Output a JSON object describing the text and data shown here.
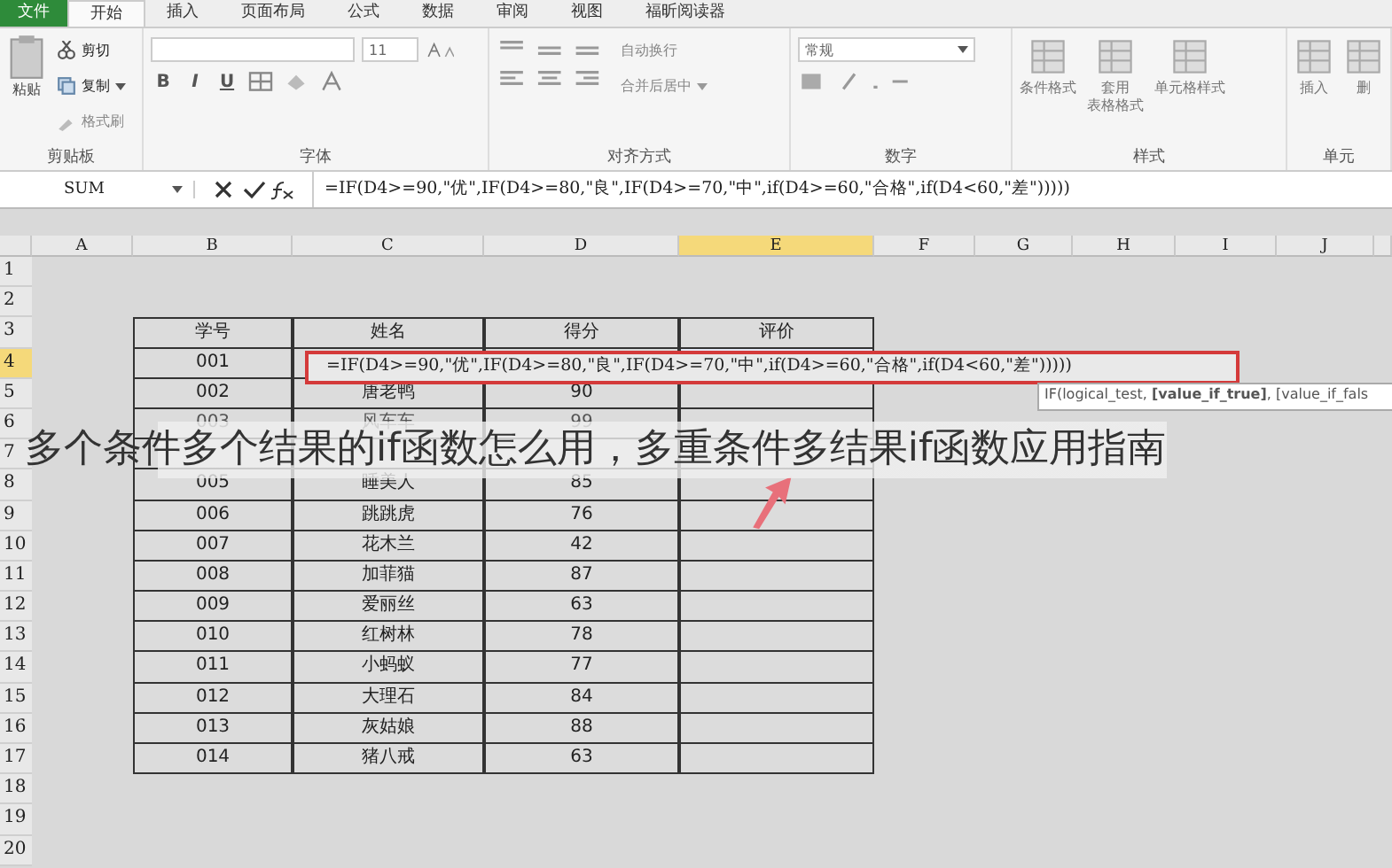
{
  "ribbon": {
    "tabs": [
      {
        "label": "文件",
        "selected": false,
        "kind": "file"
      },
      {
        "label": "开始",
        "selected": true,
        "kind": "tab"
      },
      {
        "label": "插入",
        "selected": false,
        "kind": "tab"
      },
      {
        "label": "页面布局",
        "selected": false,
        "kind": "tab"
      },
      {
        "label": "公式",
        "selected": false,
        "kind": "tab"
      },
      {
        "label": "数据",
        "selected": false,
        "kind": "tab"
      },
      {
        "label": "审阅",
        "selected": false,
        "kind": "tab"
      },
      {
        "label": "视图",
        "selected": false,
        "kind": "tab"
      },
      {
        "label": "福昕阅读器",
        "selected": false,
        "kind": "tab"
      }
    ],
    "groups": [
      {
        "kind": "clipboard",
        "label": "剪贴板",
        "paste": "粘贴",
        "cut": "剪切",
        "copy": "复制",
        "painter": "格式刷"
      },
      {
        "kind": "font",
        "label": "字体",
        "font_size": "11",
        "format_buttons": [
          "B",
          "I",
          "U"
        ]
      },
      {
        "kind": "align",
        "label": "对齐方式",
        "wrap": "自动换行",
        "merge": "合并后居中"
      },
      {
        "kind": "number",
        "label": "数字",
        "format": "常规"
      },
      {
        "kind": "styles",
        "label": "样式",
        "items": [
          [
            "条件格式"
          ],
          [
            "套用",
            "表格格式"
          ],
          [
            "单元格样式"
          ]
        ]
      },
      {
        "kind": "cells",
        "label": "单元",
        "items": [
          [
            "插入"
          ],
          [
            "删"
          ]
        ]
      }
    ]
  },
  "formula_bar": {
    "name_box": "SUM",
    "formula": "=IF(D4>=90,\"优\",IF(D4>=80,\"良\",IF(D4>=70,\"中\",if(D4>=60,\"合格\",if(D4<60,\"差\")))))"
  },
  "sheet": {
    "columns": [
      {
        "label": "A",
        "selected": false
      },
      {
        "label": "B",
        "selected": false
      },
      {
        "label": "C",
        "selected": false
      },
      {
        "label": "D",
        "selected": false
      },
      {
        "label": "E",
        "selected": true
      },
      {
        "label": "F",
        "selected": false
      },
      {
        "label": "G",
        "selected": false
      },
      {
        "label": "H",
        "selected": false
      },
      {
        "label": "I",
        "selected": false
      },
      {
        "label": "J",
        "selected": false
      }
    ],
    "row_headers": [
      {
        "label": "1",
        "selected": false
      },
      {
        "label": "2",
        "selected": false
      },
      {
        "label": "3",
        "selected": false
      },
      {
        "label": "4",
        "selected": true
      },
      {
        "label": "5",
        "selected": false
      },
      {
        "label": "6",
        "selected": false
      },
      {
        "label": "7",
        "selected": false
      },
      {
        "label": "8",
        "selected": false
      },
      {
        "label": "9",
        "selected": false
      },
      {
        "label": "10",
        "selected": false
      },
      {
        "label": "11",
        "selected": false
      },
      {
        "label": "12",
        "selected": false
      },
      {
        "label": "13",
        "selected": false
      },
      {
        "label": "14",
        "selected": false
      },
      {
        "label": "15",
        "selected": false
      },
      {
        "label": "16",
        "selected": false
      },
      {
        "label": "17",
        "selected": false
      },
      {
        "label": "18",
        "selected": false
      },
      {
        "label": "19",
        "selected": false
      },
      {
        "label": "20",
        "selected": false
      }
    ],
    "table": {
      "columns": [
        "学号",
        "姓名",
        "得分",
        "评价"
      ],
      "rows": [
        {
          "kind": "editing",
          "cells": [
            "001"
          ],
          "edit_text": "=IF(D4>=90,\"优\",IF(D4>=80,\"良\",IF(D4>=70,\"中\",if(D4>=60,\"合格\",if(D4<60,\"差\")))))"
        },
        {
          "kind": "data",
          "cells": [
            "002",
            "唐老鸭",
            "90"
          ]
        },
        {
          "kind": "faint",
          "cells": [
            "003",
            "风车车",
            "99"
          ]
        },
        {
          "kind": "covered"
        },
        {
          "kind": "data",
          "cells": [
            "005",
            "睡美人",
            "85"
          ]
        },
        {
          "kind": "data",
          "cells": [
            "006",
            "跳跳虎",
            "76"
          ]
        },
        {
          "kind": "data",
          "cells": [
            "007",
            "花木兰",
            "42"
          ]
        },
        {
          "kind": "data",
          "cells": [
            "008",
            "加菲猫",
            "87"
          ]
        },
        {
          "kind": "data",
          "cells": [
            "009",
            "爱丽丝",
            "63"
          ]
        },
        {
          "kind": "data",
          "cells": [
            "010",
            "红树林",
            "78"
          ]
        },
        {
          "kind": "data",
          "cells": [
            "011",
            "小蚂蚁",
            "77"
          ]
        },
        {
          "kind": "data",
          "cells": [
            "012",
            "大理石",
            "84"
          ]
        },
        {
          "kind": "data",
          "cells": [
            "013",
            "灰姑娘",
            "88"
          ]
        },
        {
          "kind": "data",
          "cells": [
            "014",
            "猪八戒",
            "63"
          ]
        }
      ]
    },
    "tooltip": "IF(logical_test, **[value_if_true]**, [value_if_fals"
  },
  "caption": "多个条件多个结果的if函数怎么用，多重条件多结果if函数应用指南"
}
